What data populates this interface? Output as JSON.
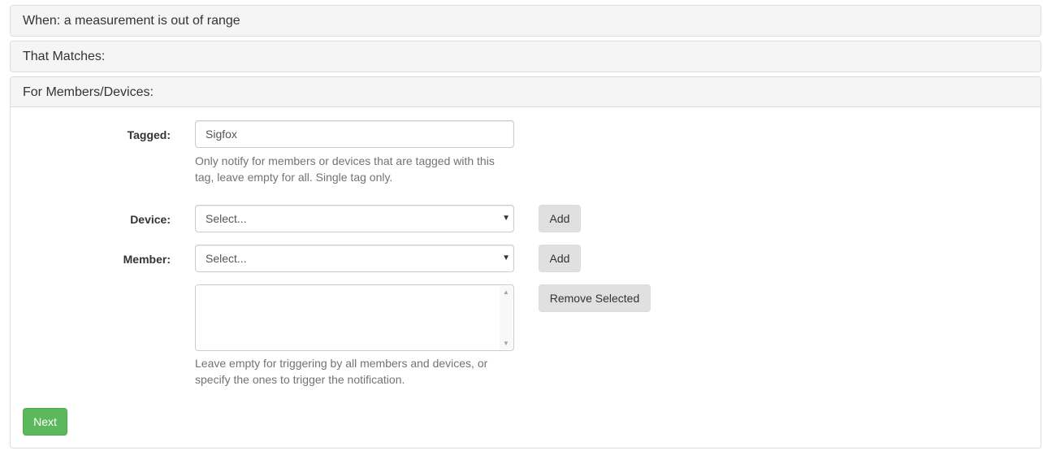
{
  "panels": {
    "when": "When: a measurement is out of range",
    "matches": "That Matches:",
    "members": "For Members/Devices:"
  },
  "form": {
    "tagged_label": "Tagged:",
    "tagged_value": "Sigfox",
    "tagged_help_line1": "Only notify for members or devices that are tagged with this",
    "tagged_help_line2": "tag, leave empty for all. Single tag only.",
    "device_label": "Device:",
    "device_selected": "Select...",
    "device_add": "Add",
    "member_label": "Member:",
    "member_selected": "Select...",
    "member_add": "Add",
    "remove_selected": "Remove Selected",
    "list_help_line1": "Leave empty for triggering by all members and devices, or",
    "list_help_line2": "specify the ones to trigger the notification.",
    "next": "Next"
  },
  "icons": {
    "dropdown": "caret-down-icon",
    "scroll_up": "scroll-up-arrow-icon",
    "scroll_down": "scroll-down-arrow-icon"
  },
  "colors": {
    "next_button": "#5cb85c",
    "default_button": "#e0e0e0",
    "panel_heading": "#f5f5f5"
  }
}
